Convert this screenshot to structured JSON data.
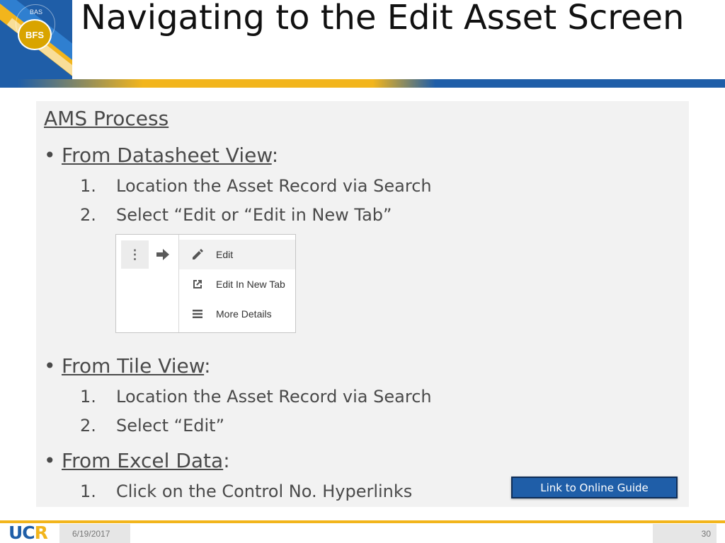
{
  "header": {
    "title": "Navigating to the Edit Asset Screen",
    "logo_top": "BAS",
    "logo_seal": "BFS"
  },
  "content": {
    "section_heading": "AMS Process",
    "bullets": [
      {
        "label": "From Datasheet View",
        "suffix": ":",
        "steps": [
          {
            "num": "1.",
            "text": "Location the Asset Record via Search"
          },
          {
            "num": "2.",
            "text": "Select “Edit or “Edit in New Tab”"
          }
        ]
      },
      {
        "label": "From Tile View",
        "suffix": ":",
        "steps": [
          {
            "num": "1.",
            "text": "Location the Asset Record via Search"
          },
          {
            "num": "2.",
            "text": "Select “Edit”"
          }
        ]
      },
      {
        "label": "From Excel Data",
        "suffix": ":",
        "steps": [
          {
            "num": "1.",
            "text": "Click on the Control No. Hyperlinks"
          }
        ]
      }
    ],
    "bullet_glyph": "•"
  },
  "menu_screenshot": {
    "kebab_icon": "vertical-dots-icon",
    "arrow_icon": "arrow-right-icon",
    "items": [
      {
        "label": "Edit",
        "icon": "pencil-icon"
      },
      {
        "label": "Edit In New Tab",
        "icon": "open-in-new-icon"
      },
      {
        "label": "More Details",
        "icon": "list-lines-icon"
      }
    ]
  },
  "link_button": {
    "label": "Link to Online Guide"
  },
  "footer": {
    "logo_text_blue_1": "UC",
    "logo_text_gold": "R",
    "date": "6/19/2017",
    "page_number": "30"
  },
  "colors": {
    "brand_blue": "#1f5ea8",
    "brand_gold": "#f2b51c",
    "panel_gray": "#f2f2f2",
    "text_gray": "#4a4a4a"
  }
}
